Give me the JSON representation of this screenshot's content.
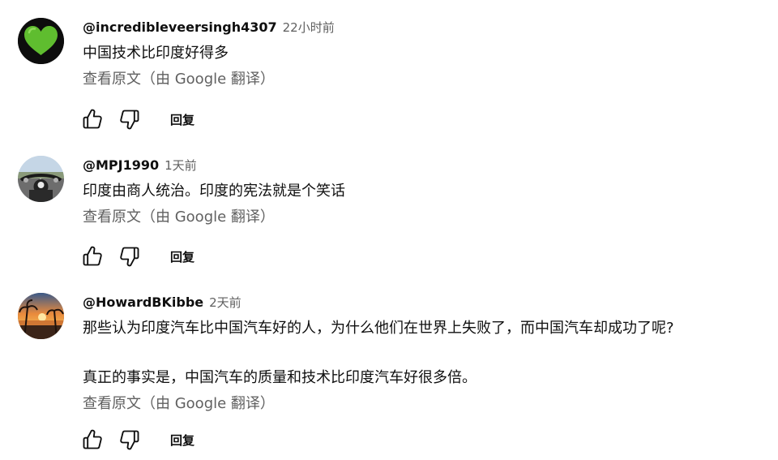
{
  "comments": [
    {
      "author": "@incredibleveersingh4307",
      "time": "22小时前",
      "lines": [
        "中国技术比印度好得多"
      ],
      "translate_label": "查看原文（由 Google 翻译）",
      "reply_label": "回复",
      "avatar_icon": "green-heart-icon"
    },
    {
      "author": "@MPJ1990",
      "time": "1天前",
      "lines": [
        "印度由商人统治。印度的宪法就是个笑话"
      ],
      "translate_label": "查看原文（由 Google 翻译）",
      "reply_label": "回复",
      "avatar_icon": "motorcycle-photo"
    },
    {
      "author": "@HowardBKibbe",
      "time": "2天前",
      "lines": [
        "那些认为印度汽车比中国汽车好的人，为什么他们在世界上失败了，而中国汽车却成功了呢?",
        "",
        "真正的事实是，中国汽车的质量和技术比印度汽车好很多倍。"
      ],
      "translate_label": "查看原文（由 Google 翻译）",
      "reply_label": "回复",
      "avatar_icon": "sunset-photo"
    }
  ],
  "icons": {
    "like": "thumb-up-icon",
    "dislike": "thumb-down-icon"
  },
  "colors": {
    "text_primary": "#0f0f0f",
    "text_secondary": "#606060",
    "heart_green": "#5fbd2f"
  }
}
